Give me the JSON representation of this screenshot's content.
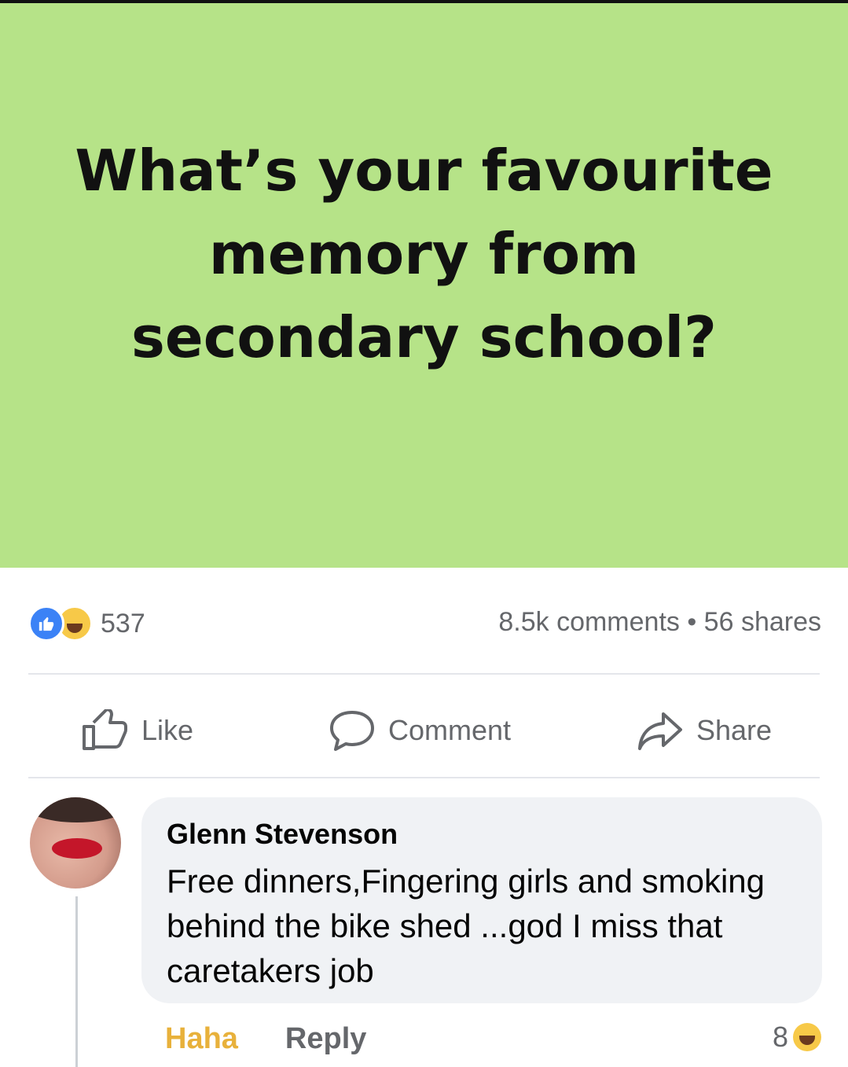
{
  "post": {
    "text": "What’s your favourite memory from secondary school?",
    "background_color": "#b6e388"
  },
  "stats": {
    "reaction_count": "537",
    "comments_and_shares": "8.5k comments • 56 shares",
    "reaction_icons": [
      "like-icon",
      "haha-icon"
    ]
  },
  "actions": {
    "like": "Like",
    "comment": "Comment",
    "share": "Share"
  },
  "comment": {
    "author": "Glenn Stevenson",
    "text": "Free dinners,Fingering girls and smoking behind the bike shed ...god I miss that caretakers job",
    "haha_label": "Haha",
    "reply_label": "Reply",
    "reaction_count": "8",
    "reaction_icon": "haha-icon"
  }
}
